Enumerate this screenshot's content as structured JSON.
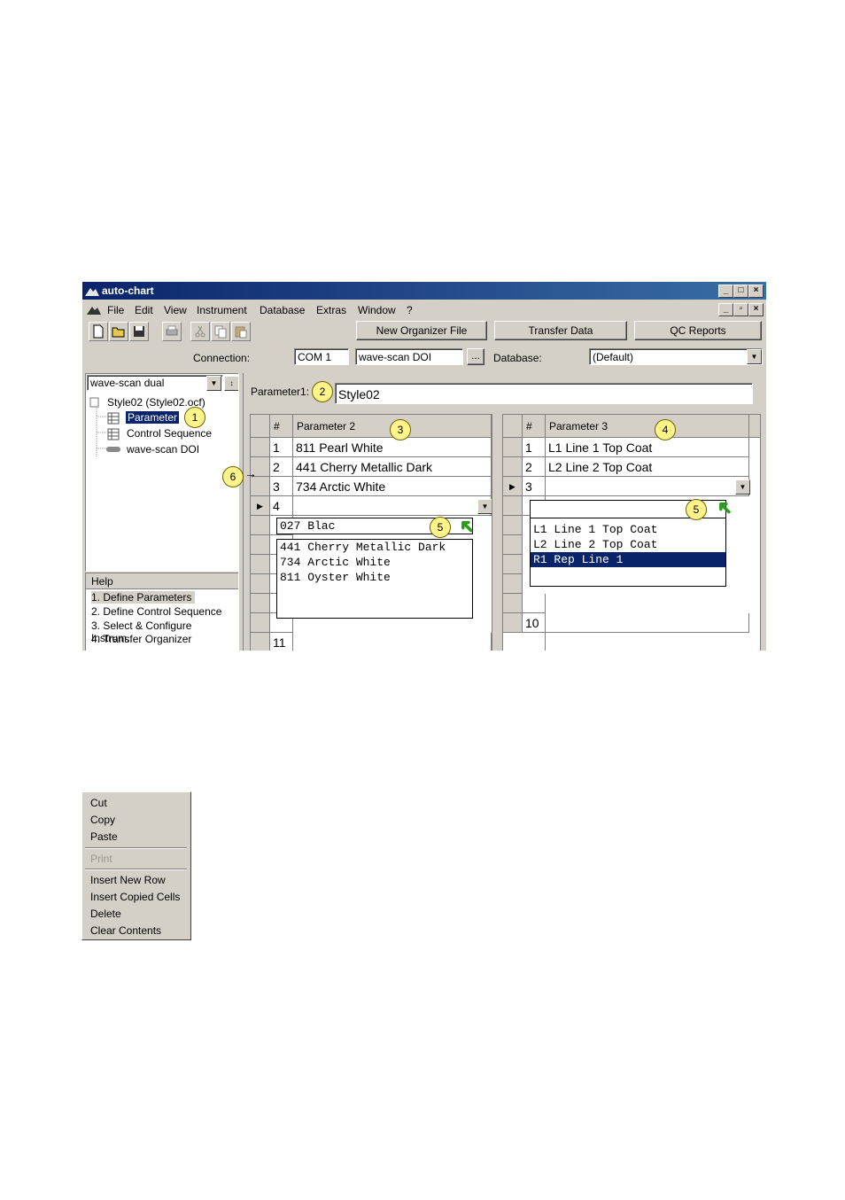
{
  "window": {
    "title": "auto-chart"
  },
  "menu": [
    "File",
    "Edit",
    "View",
    "Instrument",
    "Database",
    "Extras",
    "Window",
    "?"
  ],
  "toolbar": {
    "new_organizer": "New Organizer File",
    "transfer_data": "Transfer Data",
    "qc_reports": "QC Reports"
  },
  "connection": {
    "label": "Connection:",
    "port": "COM 1",
    "device": "wave-scan DOI",
    "browse": "..."
  },
  "database": {
    "label": "Database:",
    "value": "(Default)"
  },
  "tree": {
    "instrument": "wave-scan dual",
    "root": "Style02  (Style02.ocf)",
    "items": [
      "Parameter",
      "Control Sequence",
      "wave-scan DOI"
    ]
  },
  "help": {
    "title": "Help",
    "steps": [
      "1. Define Parameters",
      "2. Define Control Sequence",
      "3. Select & Configure Instrum...",
      "4. Transfer Organizer"
    ]
  },
  "parameter1": {
    "label": "Parameter1:",
    "value": "Style02"
  },
  "grid2": {
    "col_num": "#",
    "col_name": "Parameter 2",
    "rows": [
      {
        "n": "1",
        "v": "811 Pearl White"
      },
      {
        "n": "2",
        "v": "441 Cherry Metallic Dark"
      },
      {
        "n": "3",
        "v": "734 Arctic White"
      },
      {
        "n": "4",
        "v": ""
      }
    ],
    "last_row": "11",
    "edit_value": "027 Blac",
    "options": [
      "441 Cherry Metallic Dark",
      "734 Arctic White",
      "811 Oyster White"
    ]
  },
  "grid3": {
    "col_num": "#",
    "col_name": "Parameter 3",
    "rows": [
      {
        "n": "1",
        "v": "L1 Line 1 Top Coat"
      },
      {
        "n": "2",
        "v": "L2 Line 2 Top Coat"
      },
      {
        "n": "3",
        "v": ""
      }
    ],
    "last_row": "10",
    "options": [
      "L1 Line 1 Top Coat",
      "L2 Line 2 Top Coat",
      "R1 Rep Line 1"
    ],
    "selected_option": 2
  },
  "callouts": [
    "1",
    "2",
    "3",
    "4",
    "5",
    "5",
    "6"
  ],
  "context_menu": {
    "cut": "Cut",
    "copy": "Copy",
    "paste": "Paste",
    "print": "Print",
    "insert_row": "Insert New Row",
    "insert_cells": "Insert Copied Cells",
    "delete": "Delete",
    "clear": "Clear Contents"
  },
  "colors": {
    "title_start": "#0a246a",
    "title_end": "#3a6ea5",
    "selection": "#0a246a",
    "callout": "#fff48a",
    "arrow": "#2a9a1a"
  },
  "icons": [
    "app-logo-icon",
    "new-file-icon",
    "open-folder-icon",
    "save-icon",
    "print-icon",
    "cut-icon",
    "copy-icon",
    "paste-icon",
    "grid-icon",
    "instrument-icon"
  ]
}
